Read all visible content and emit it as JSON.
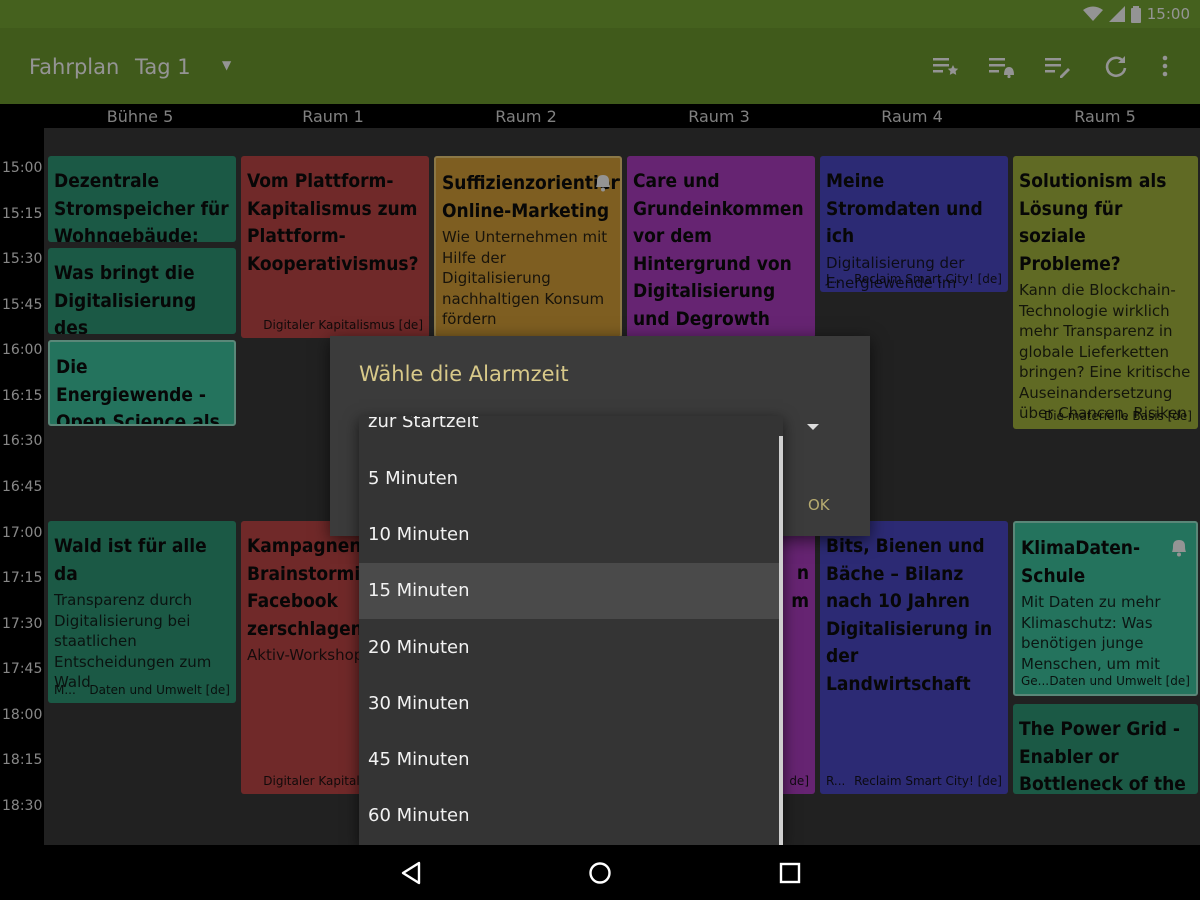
{
  "status_bar": {
    "time": "15:00",
    "icons": [
      "wifi-icon",
      "signal-icon",
      "battery-icon"
    ]
  },
  "toolbar": {
    "title": "Fahrplan",
    "day": "Tag 1",
    "actions": [
      "starred-list-icon",
      "alarms-list-icon",
      "edit-list-icon",
      "refresh-icon",
      "overflow-menu-icon"
    ]
  },
  "columns": [
    "Bühne 5",
    "Raum 1",
    "Raum 2",
    "Raum 3",
    "Raum 4",
    "Raum 5"
  ],
  "times": [
    "15:00",
    "15:15",
    "15:30",
    "15:45",
    "16:00",
    "16:15",
    "16:30",
    "16:45",
    "17:00",
    "17:15",
    "17:30",
    "17:45",
    "18:00",
    "18:15",
    "18:30"
  ],
  "events": [
    {
      "title": "Dezentrale Stromspeicher für Wohngebäude:",
      "subtitle": "",
      "speaker": "",
      "track": "",
      "color": "#2f9a78",
      "alarm": false
    },
    {
      "title": "Was bringt die Digitalisierung des Energieversor-",
      "subtitle": "",
      "speaker": "",
      "track": "",
      "color": "#2f9a78",
      "alarm": false
    },
    {
      "title": "Die Energiewende - Open Science als Weg zur",
      "subtitle": "",
      "speaker": "",
      "track": "",
      "color": "#3fc7a0",
      "alarm": false
    },
    {
      "title": "Wald ist für alle da",
      "subtitle": "Transparenz durch Digitalisierung bei staatlichen Entscheidungen zum Wald",
      "speaker": "M...",
      "track": "Daten und Umwelt [de]",
      "color": "#2f9a78",
      "alarm": false
    },
    {
      "title": "Vom Plattform-Kapitalismus zum Plattform-Kooperativismus?",
      "subtitle": "",
      "speaker": "",
      "track": "Digitaler Kapitalismus [de]",
      "color": "#c24747",
      "alarm": false
    },
    {
      "title": "Kampagnen-Brainstorming: Facebook zerschlagen?",
      "subtitle": "Aktiv-Workshop",
      "speaker": "",
      "track": "Digitaler Kapitalismus [de]",
      "color": "#c24747",
      "alarm": false
    },
    {
      "title": "Suffizienzorientiertes Online-Marketing",
      "subtitle": "Wie Unternehmen mit Hilfe der Digitalisierung nachhaltigen Konsum fördern",
      "speaker": "",
      "track": "",
      "color": "#d9a23a",
      "alarm": true
    },
    {
      "title": "Care und Grundeinkommen vor dem Hintergrund von Digitalisierung und Degrowth",
      "subtitle": "",
      "speaker": "",
      "track": "",
      "color": "#b03fc4",
      "alarm": false
    },
    {
      "title": "Meine Stromdaten und ich",
      "subtitle": "Digitalisierung der Energiewende im",
      "speaker": "J...",
      "track": "Reclaim Smart City! [de]",
      "color": "#4d49c9",
      "alarm": false
    },
    {
      "title": "Bits, Bienen und Bäche – Bilanz nach 10 Jahren Digitalisierung in der Landwirtschaft",
      "subtitle": "",
      "speaker": "R...",
      "track": "Reclaim Smart City! [de]",
      "color": "#4d49c9",
      "alarm": false
    },
    {
      "title": "Solutionism als Lösung für soziale Probleme?",
      "subtitle": "Kann die Blockchain-Technologie wirklich mehr Transparenz in globale Lieferketten bringen? Eine kritische Auseinandersetzung über Chancen, Risiken",
      "speaker": "",
      "track": "Die materielle Basis [de]",
      "color": "#a6b73f",
      "alarm": false
    },
    {
      "title": "KlimaDaten-Schule",
      "subtitle": "Mit Daten zu mehr Klimaschutz: Was benötigen junge Menschen, um mit",
      "speaker": "Ge...",
      "track": "Daten und Umwelt [de]",
      "color": "#3fc7a0",
      "alarm": true
    },
    {
      "title": "The Power Grid - Enabler or Bottleneck of the",
      "subtitle": "",
      "speaker": "",
      "track": "",
      "color": "#2f9a78",
      "alarm": false
    }
  ],
  "partial_texts": {
    "raum3_lower_a": "n",
    "raum3_lower_b": "m",
    "raum3_track": "de]"
  },
  "dialog": {
    "title": "Wähle die Alarmzeit",
    "ok_label": "OK"
  },
  "dropdown": {
    "options": [
      "zur Startzeit",
      "5 Minuten",
      "10 Minuten",
      "15 Minuten",
      "20 Minuten",
      "30 Minuten",
      "45 Minuten",
      "60 Minuten"
    ],
    "selected": "15 Minuten"
  }
}
